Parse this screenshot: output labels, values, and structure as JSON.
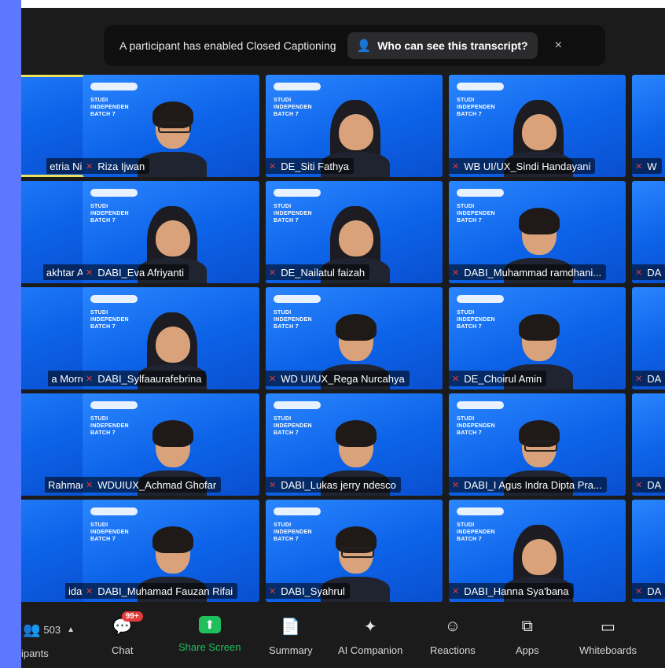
{
  "banner": {
    "message": "A participant has enabled Closed Captioning",
    "button_label": "Who can see this transcript?",
    "close_label": "×"
  },
  "promo": {
    "line1": "STUDI",
    "line2": "INDEPENDEN",
    "line3": "BATCH 7"
  },
  "tiles": [
    {
      "name": "etria Niisa"
    },
    {
      "name": "Riza Ijwan"
    },
    {
      "name": "DE_Siti Fathya"
    },
    {
      "name": "WB UI/UX_Sindi Handayani"
    },
    {
      "name": "W"
    },
    {
      "name": "akhtar Ariq"
    },
    {
      "name": "DABI_Eva Afriyanti"
    },
    {
      "name": "DE_Nailatul faizah"
    },
    {
      "name": "DABI_Muhammad ramdhani..."
    },
    {
      "name": "DA"
    },
    {
      "name": "a Morro..."
    },
    {
      "name": "DABI_Sylfaaurafebrina"
    },
    {
      "name": "WD UI/UX_Rega Nurcahya"
    },
    {
      "name": "DE_Choirul Amin"
    },
    {
      "name": "DA"
    },
    {
      "name": "Rahmad..."
    },
    {
      "name": "WDUIUX_Achmad Ghofar"
    },
    {
      "name": "DABI_Lukas jerry ndesco"
    },
    {
      "name": "DABI_I Agus Indra Dipta Pra..."
    },
    {
      "name": "DA"
    },
    {
      "name": "idayih"
    },
    {
      "name": "DABI_Muhamad Fauzan Rifai"
    },
    {
      "name": "DABI_Syahrul"
    },
    {
      "name": "DABI_Hanna Sya'bana"
    },
    {
      "name": "DA"
    }
  ],
  "toolbar": {
    "participants_count": "503",
    "participants_label": "ipants",
    "chat_label": "Chat",
    "chat_badge": "99+",
    "share_label": "Share Screen",
    "summary_label": "Summary",
    "ai_label": "AI Companion",
    "reactions_label": "Reactions",
    "apps_label": "Apps",
    "whiteboards_label": "Whiteboards"
  }
}
